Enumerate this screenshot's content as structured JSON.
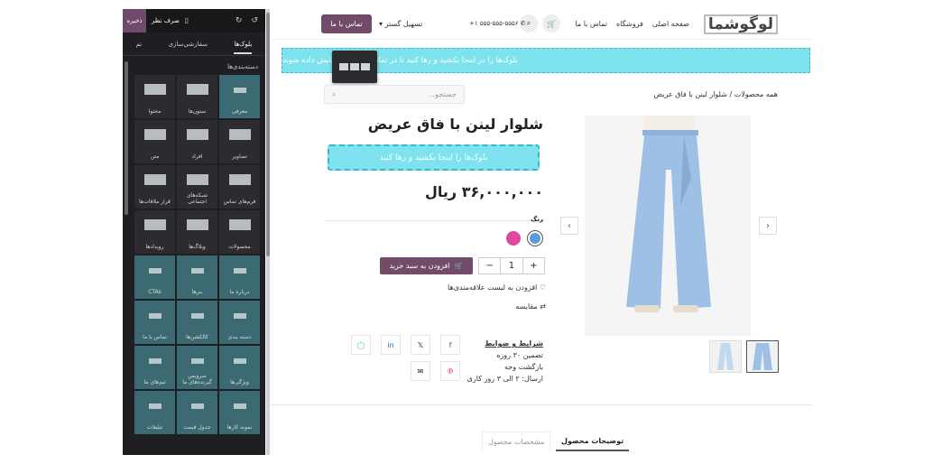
{
  "editor": {
    "save_label": "ذخیره",
    "discard_label": "صرف نظر",
    "tabs": [
      "بلوک‌ها",
      "سفارشی‌سازی",
      "تم"
    ],
    "section_title": "دسته‌بندی‌ها",
    "blocks": [
      {
        "label": "معرفی",
        "teal": true
      },
      {
        "label": "ستون‌ها",
        "teal": false
      },
      {
        "label": "محتوا",
        "teal": false
      },
      {
        "label": "تصاویر",
        "teal": false
      },
      {
        "label": "افراد",
        "teal": false
      },
      {
        "label": "متن",
        "teal": false
      },
      {
        "label": "فرم‌های تماس",
        "teal": false
      },
      {
        "label": "شبکه‌های اجتماعی",
        "teal": false
      },
      {
        "label": "قرار ملاقات‌ها",
        "teal": false
      },
      {
        "label": "محصولات",
        "teal": false
      },
      {
        "label": "وبلاگ‌ها",
        "teal": false
      },
      {
        "label": "رویدادها",
        "teal": false
      },
      {
        "label": "درباره ما",
        "teal": true
      },
      {
        "label": "بنرها",
        "teal": true
      },
      {
        "label": "CTAs",
        "teal": true
      },
      {
        "label": "دسته بندی",
        "teal": true
      },
      {
        "label": "کالکشن‌ها",
        "teal": true
      },
      {
        "label": "تماس با ما",
        "teal": true
      },
      {
        "label": "ویژگی‌ها",
        "teal": true
      },
      {
        "label": "سرویس گیرنده‌های ما",
        "teal": true
      },
      {
        "label": "تیم‌های ما",
        "teal": true
      },
      {
        "label": "نمونه کارها",
        "teal": true
      },
      {
        "label": "جدول قیمت",
        "teal": true
      },
      {
        "label": "تبلیغات",
        "teal": true
      }
    ]
  },
  "header": {
    "logo": "لوگوشما",
    "nav": [
      "صفحه اصلی",
      "فروشگاه",
      "تماس با ما"
    ],
    "phone": "+۱ ۵۵۵-۵۵۵-۵۵۵۶",
    "accessibility": "تسهیل گستر",
    "contact_button": "تماس با ما"
  },
  "banner": "بلوک‌ها را در اینجا بکشید و رها کنید تا در تمام محصولات نمایش داده شوند",
  "search_placeholder": "جستجو...",
  "breadcrumb": {
    "root": "همه محصولات",
    "sep": "/",
    "current": "شلوار لینن با فاق عریض"
  },
  "product": {
    "title": "شلوار لینن با فاق عریض",
    "dropzone": "بلوک‌ها را اینجا بکشید و رها کنید",
    "price": "۳۶,۰۰۰,۰۰۰ ریال",
    "color_label": "رنگ",
    "colors": [
      "#5b9bdc",
      "#e0479e"
    ],
    "quantity": "1",
    "add_to_cart": "افزودن به سبد خرید",
    "wishlist": "افزودن به لیست علاقه‌مندی‌ها",
    "compare": "مقایسه",
    "terms": "شرایط و ضوابط",
    "guarantee": "تضمین ۳۰ روزه",
    "refund": "بازگشت وجه",
    "shipping": "ارسال: ۲ الی ۳ روز کاری"
  },
  "tabs": {
    "description": "توضیحات محصول",
    "specs": "مشخصات محصول"
  }
}
